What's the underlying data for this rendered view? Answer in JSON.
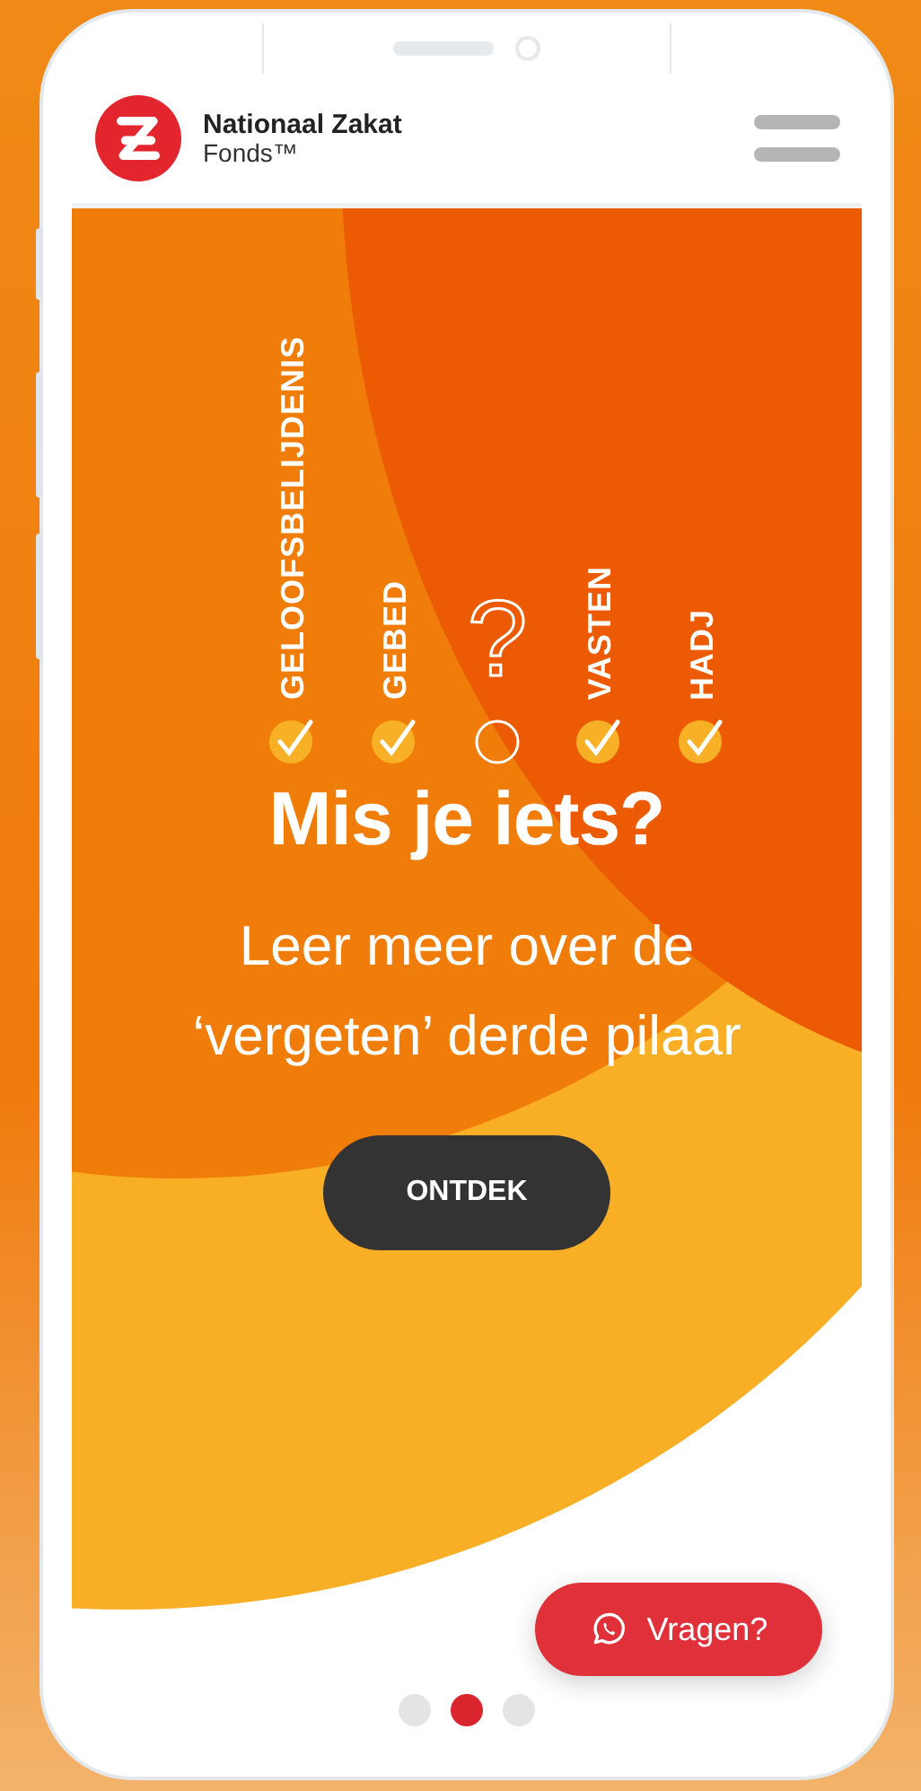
{
  "header": {
    "brand_name": "Nationaal Zakat",
    "brand_sub": "Fonds™"
  },
  "hero": {
    "pillars": [
      {
        "kind": "text",
        "label": "GELOOFSBELIJDENIS",
        "checked": true
      },
      {
        "kind": "text",
        "label": "GEBED",
        "checked": true
      },
      {
        "kind": "question",
        "label": "?",
        "checked": false
      },
      {
        "kind": "text",
        "label": "VASTEN",
        "checked": true
      },
      {
        "kind": "text",
        "label": "HADJ",
        "checked": true
      }
    ],
    "title": "Mis je iets?",
    "subtitle": "Leer meer over de ‘vergeten’ derde pilaar",
    "button": "ONTDEK"
  },
  "chat_button": "Vragen?",
  "pager": [
    {
      "selected": false
    },
    {
      "selected": true
    },
    {
      "selected": false
    }
  ]
}
